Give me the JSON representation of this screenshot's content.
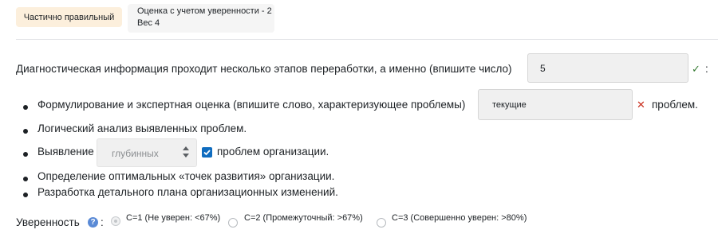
{
  "status": {
    "badge": "Частично правильный"
  },
  "grade": {
    "line1": "Оценка с учетом уверенности - 2",
    "line2": "Вес 4"
  },
  "question": {
    "intro": "Диагностическая информация проходит несколько этапов переработки, а именно (впишите число)",
    "answer1": "5",
    "after1": ":",
    "item1_before": "Формулирование и экспертная оценка (впишите слово, характеризующее проблемы)",
    "answer2": "текущие",
    "item1_after": "проблем.",
    "item2": "Логический анализ выявленных проблем.",
    "item3_before": "Выявление",
    "select_value": "глубинных",
    "item3_after": "проблем организации.",
    "item4": "Определение оптимальных «точек развития» организации.",
    "item5": "Разработка детального плана организационных изменений."
  },
  "confidence": {
    "label": "Уверенность",
    "colon": ":",
    "help_glyph": "?",
    "options": [
      "C=1 (Не уверен: <67%)",
      "C=2 (Промежуточный: >67%)",
      "C=3 (Совершенно уверен: >80%)"
    ],
    "selected_index": 0
  },
  "icons": {
    "correct": "check-icon",
    "incorrect": "cross-icon",
    "help": "question-circle-icon",
    "select_arrows": "sort-arrows-icon"
  },
  "colors": {
    "correct": "#357a32",
    "incorrect": "#ca3120",
    "checkbox": "#0f6cbf",
    "badge_bg": "#fcefdc"
  }
}
